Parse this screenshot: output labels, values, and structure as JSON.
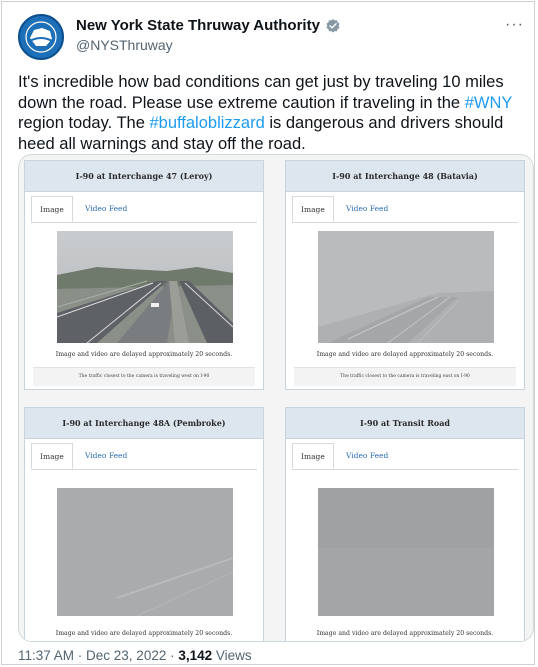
{
  "account": {
    "display_name": "New York State Thruway Authority",
    "handle": "@NYSThruway",
    "avatar_icon": "nys-thruway-logo",
    "badge_icon": "verified-badge-icon",
    "badge_color": "#8899a6",
    "more_glyph": "···"
  },
  "tweet": {
    "text_1": "It's incredible how bad conditions can get just by traveling 10 miles down the road. Please use extreme caution if traveling in the ",
    "hashtag_1": "#WNY",
    "text_2": " region today. The ",
    "hashtag_2": "#buffaloblizzard",
    "text_3": " is dangerous and drivers should heed all warnings and stay off the road.",
    "link_color": "#1d9bf0"
  },
  "cameras": [
    {
      "title": "I-90 at Interchange 47 (Leroy)",
      "tab_image": "Image",
      "tab_video": "Video Feed",
      "delay_note": "Image and video are delayed approximately 20 seconds.",
      "traffic_note": "The traffic closest to the camera is traveling west on I-90"
    },
    {
      "title": "I-90 at Interchange 48 (Batavia)",
      "tab_image": "Image",
      "tab_video": "Video Feed",
      "delay_note": "Image and video are delayed approximately 20 seconds.",
      "traffic_note": "The traffic closest to the camera is traveling east on I-90"
    },
    {
      "title": "I-90 at Interchange 48A (Pembroke)",
      "tab_image": "Image",
      "tab_video": "Video Feed",
      "delay_note": "Image and video are delayed approximately 20 seconds."
    },
    {
      "title": "I-90 at Transit Road",
      "tab_image": "Image",
      "tab_video": "Video Feed",
      "delay_note": "Image and video are delayed approximately 20 seconds."
    }
  ],
  "footer": {
    "timestamp": "11:37 AM · Dec 23, 2022 · ",
    "views_count": "3,142",
    "views_label": " Views"
  }
}
